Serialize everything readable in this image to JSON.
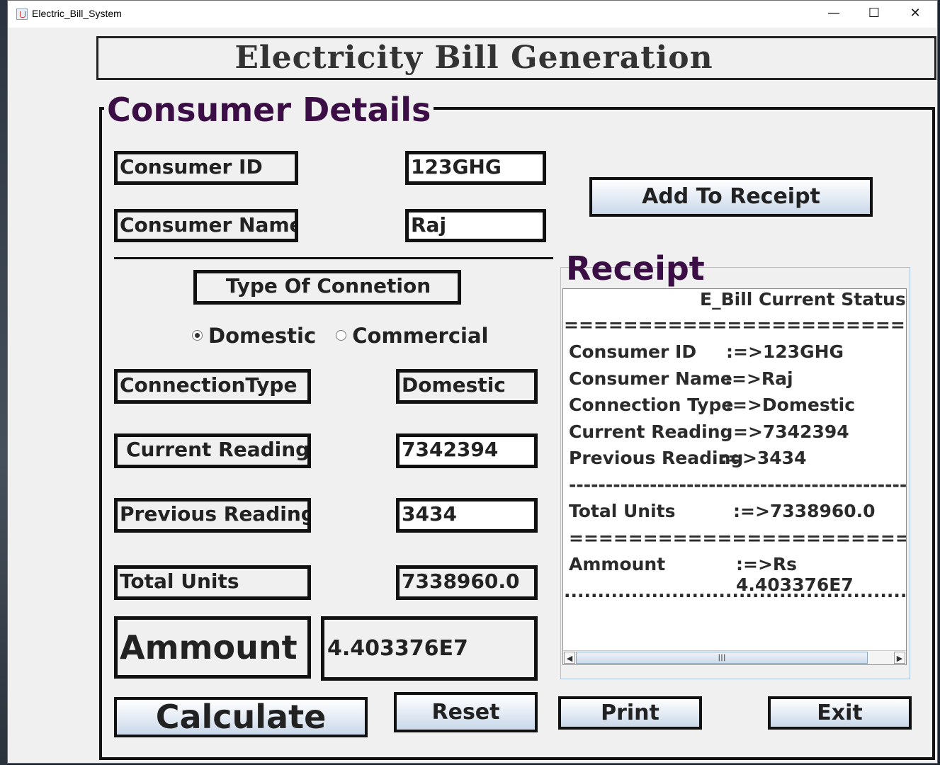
{
  "window": {
    "title": "Electric_Bill_System",
    "minimize_glyph": "—",
    "maximize_glyph": "☐",
    "close_glyph": "✕"
  },
  "heading": "Electricity Bill Generation",
  "consumer_section": {
    "legend": "Consumer Details"
  },
  "fields": {
    "consumer_id": {
      "label": "Consumer ID",
      "value": "123GHG"
    },
    "consumer_name": {
      "label": "Consumer Name",
      "value": "Raj"
    },
    "connection_type": {
      "label": "ConnectionType",
      "value": "Domestic"
    },
    "current_reading": {
      "label": "Current Reading",
      "value": "7342394"
    },
    "previous_reading": {
      "label": "Previous Reading",
      "value": "3434"
    },
    "total_units": {
      "label": "Total Units",
      "value": "7338960.0"
    },
    "amount": {
      "label": "Ammount",
      "value": "4.403376E7"
    }
  },
  "connection_group": {
    "label": "Type Of Connetion",
    "options": [
      {
        "label": "Domestic",
        "selected": true
      },
      {
        "label": "Commercial",
        "selected": false
      }
    ]
  },
  "buttons": {
    "add_to_receipt": "Add To Receipt",
    "calculate": "Calculate",
    "reset": "Reset",
    "print": "Print",
    "exit": "Exit"
  },
  "receipt": {
    "title": "Receipt",
    "status_header": "E_Bill Current Status",
    "separator_eq": "============================",
    "rows": [
      {
        "key": "Consumer ID",
        "value": ":=>123GHG"
      },
      {
        "key": "Consumer Name",
        "value": ":=>Raj"
      },
      {
        "key": "Connection Type",
        "value": ":=>Domestic"
      },
      {
        "key": "Current Reading",
        "value": ":=>7342394"
      },
      {
        "key": "Previous Reading",
        "value": ":=>3434"
      }
    ],
    "separator_dash": "----------------------------------------------",
    "total_units": {
      "key": "Total Units",
      "value": ":=>7338960.0"
    },
    "separator_eq2": "===========================",
    "amount": {
      "key": "Ammount",
      "value": ":=>Rs 4.403376E7"
    },
    "separator_dots": "...............................................................",
    "scroll_thumb_glyph": "|||"
  },
  "colors": {
    "legend_text": "#3b0f45",
    "window_bg": "#f0f0f0",
    "border": "#111111"
  }
}
